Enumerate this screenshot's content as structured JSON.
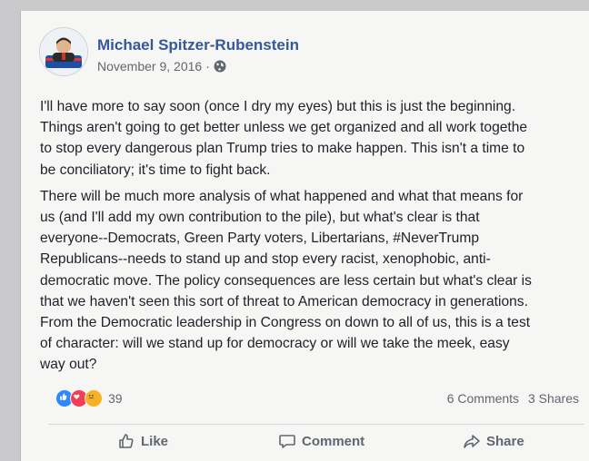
{
  "post": {
    "author": "Michael Spitzer-Rubenstein",
    "date": "November 9, 2016",
    "date_separator": "·",
    "privacy_icon": "globe-icon",
    "lines_para1": [
      "I'll have more to say soon (once I dry my eyes) but this is just the beginning.",
      "Things aren't going to get better unless we get organized and all work togethe",
      "to stop every dangerous plan Trump tries to make happen. This isn't a time to",
      "be conciliatory; it's time to fight back."
    ],
    "lines_para2": [
      "There will be much more analysis of what happened and what that means for",
      "us (and I'll add my own contribution to the pile), but what's clear is that",
      "everyone--Democrats, Green Party voters, Libertarians, #NeverTrump",
      "Republicans--needs to stand up and stop every racist, xenophobic, anti-",
      "democratic move. The policy consequences are less certain but what's clear is",
      "that we haven't seen this sort of threat to American democracy in generations.",
      "From the Democratic leadership in Congress on down to all of us, this is a test",
      "of character: will we stand up for democracy or will we take the meek, easy",
      "way out?"
    ]
  },
  "reactions": {
    "icons": [
      "like-reaction-icon",
      "love-reaction-icon",
      "sad-reaction-icon"
    ],
    "count": "39"
  },
  "stats": {
    "comments": "6 Comments",
    "shares": "3 Shares"
  },
  "actions": {
    "like": "Like",
    "comment": "Comment",
    "share": "Share"
  },
  "colors": {
    "name": "#365899",
    "meta": "#616770",
    "text": "#1d2129",
    "like": "#2d88ff",
    "love": "#f33e58",
    "sad": "#f7b125"
  }
}
